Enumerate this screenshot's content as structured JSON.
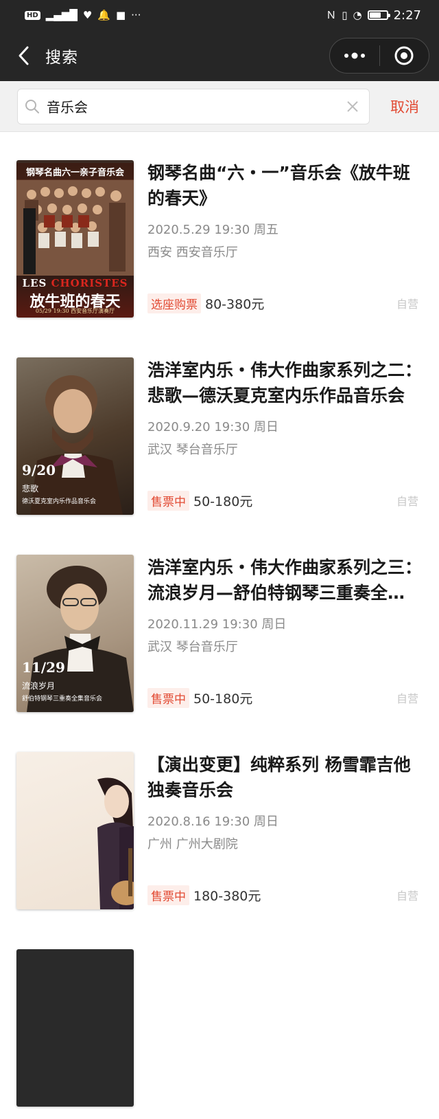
{
  "status_bar": {
    "left_badges": [
      "HD",
      "46",
      "♡",
      "🔔",
      "咏"
    ],
    "time": "2:27",
    "battery_percent": 70
  },
  "nav": {
    "title": "搜索"
  },
  "search": {
    "value": "音乐会",
    "cancel_label": "取消"
  },
  "results": [
    {
      "title": "钢琴名曲“六・一”音乐会《放牛班的春天》",
      "date": "2020.5.29 19:30 周五",
      "venue": "西安 西安音乐厅",
      "tag": "选座购票",
      "price": "80-380元",
      "self_operated": "自营",
      "poster": {
        "top_text": "钢琴名曲六一亲子音乐会",
        "les": "LES ",
        "choristes": "CHORISTES",
        "big": "放牛班的春天",
        "small": "05/29 19:30 西安音乐厅演奏厅"
      }
    },
    {
      "title": "浩洋室内乐・伟大作曲家系列之二：悲歌—德沃夏克室内乐作品音乐会",
      "date": "2020.9.20 19:30 周日",
      "venue": "武汉 琴台音乐厅",
      "tag": "售票中",
      "price": "50-180元",
      "self_operated": "自营",
      "poster": {
        "date": "9/20",
        "sub": "悲歌",
        "sub2": "德沃夏克室内乐作品音乐会"
      }
    },
    {
      "title": "浩洋室内乐・伟大作曲家系列之三：流浪岁月—舒伯特钢琴三重奏全集音乐会",
      "date": "2020.11.29 19:30 周日",
      "venue": "武汉 琴台音乐厅",
      "tag": "售票中",
      "price": "50-180元",
      "self_operated": "自营",
      "poster": {
        "date": "11/29",
        "sub": "流浪岁月",
        "sub2": "舒伯特钢琴三重奏全集音乐会"
      }
    },
    {
      "title": "【演出变更】纯粹系列 杨雪霏吉他独奏音乐会",
      "date": "2020.8.16 19:30 周日",
      "venue": "广州 广州大剧院",
      "tag": "售票中",
      "price": "180-380元",
      "self_operated": "自营"
    }
  ],
  "colors": {
    "accent": "#e24a33",
    "header_bg": "#262626",
    "muted_text": "#8a8a8a"
  }
}
